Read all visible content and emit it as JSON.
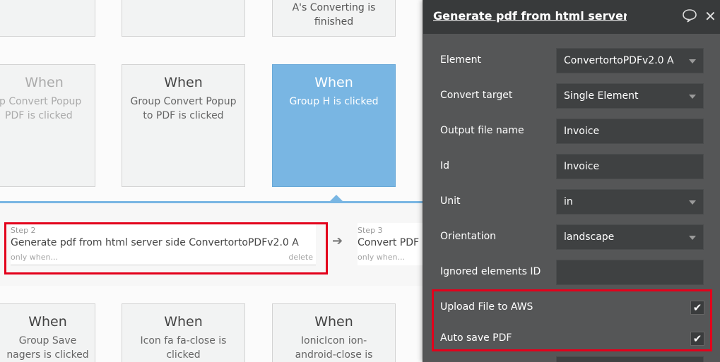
{
  "canvas": {
    "row1": [
      {
        "text": ""
      },
      {
        "text": ""
      },
      {
        "line1": "A's Converting is",
        "line2": "finished"
      }
    ],
    "row2": [
      {
        "when": "When",
        "line1": "p Convert Popup",
        "line2": "PDF is clicked"
      },
      {
        "when": "When",
        "line1": "Group Convert Popup",
        "line2": "to PDF is clicked"
      },
      {
        "when": "When",
        "line1": "Group H is clicked",
        "line2": ""
      }
    ],
    "row3": [
      {
        "when": "When",
        "line1": "Group Save",
        "line2": "nagers is clicked"
      },
      {
        "when": "When",
        "line1": "Icon fa fa-close is",
        "line2": "clicked"
      },
      {
        "when": "When",
        "line1": "IonicIcon ion-",
        "line2": "android-close is"
      }
    ]
  },
  "steps": [
    {
      "num": "Step 2",
      "title": "Generate pdf from html server side ConvertortoPDFv2.0 A",
      "cond": "only when...",
      "delete": "delete"
    },
    {
      "num": "Step 3",
      "title": "Convert PDF",
      "cond": "only when..."
    }
  ],
  "panel": {
    "title": "Generate pdf from html server side",
    "fields": [
      {
        "label": "Element",
        "value": "ConvertortoPDFv2.0 A",
        "dropdown": true
      },
      {
        "label": "Convert target",
        "value": "Single Element",
        "dropdown": true
      },
      {
        "label": "Output file name",
        "value": "Invoice",
        "dropdown": false
      },
      {
        "label": "Id",
        "value": "Invoice",
        "dropdown": false
      },
      {
        "label": "Unit",
        "value": "in",
        "dropdown": true
      },
      {
        "label": "Orientation",
        "value": "landscape",
        "dropdown": true
      },
      {
        "label": "Ignored elements ID",
        "value": "",
        "dropdown": false
      }
    ],
    "checkboxes": [
      {
        "label": "Upload File to AWS",
        "checked": true,
        "mark": "✔"
      },
      {
        "label": "Auto save PDF",
        "checked": true,
        "mark": "✔"
      }
    ]
  },
  "colors": {
    "active_card": "#79b6e3",
    "panel_bg": "#555657",
    "panel_header": "#383a3b",
    "highlight": "#e3001b"
  }
}
